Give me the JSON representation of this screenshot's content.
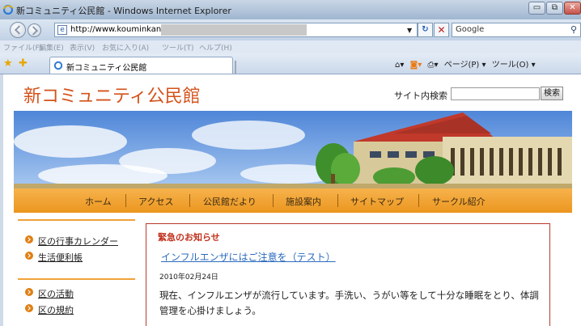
{
  "browser": {
    "window_title": "新コミュニティ公民館 - Windows Internet Explorer",
    "url": "http://www.kouminkan.info",
    "search_engine": "Google",
    "menu": [
      "ファイル(F)",
      "編集(E)",
      "表示(V)",
      "お気に入り(A)",
      "ツール(T)",
      "ヘルプ(H)"
    ],
    "tab_title": "新コミュニティ公民館",
    "toolbar_page": "ページ(P) ▾",
    "toolbar_tools": "ツール(O) ▾",
    "win_min": "▭",
    "win_max": "⧉",
    "win_close": "✕"
  },
  "site": {
    "title": "新コミュニティ公民館",
    "search_label": "サイト内検索",
    "search_button": "検索",
    "nav": [
      "ホーム",
      "アクセス",
      "公民館だより",
      "施設案内",
      "サイトマップ",
      "サークル紹介"
    ],
    "sidebar_group1": [
      "区の行事カレンダー",
      "生活便利帳"
    ],
    "sidebar_group2": [
      "区の活動",
      "区の規約"
    ],
    "notice": {
      "heading": "緊急のお知らせ",
      "link": "インフルエンザにはご注意を（テスト）",
      "date": "2010年02月24日",
      "body": "現在、インフルエンザが流行しています。手洗い、うがい等をして十分な睡眠をとり、体調管理を心掛けましょう。"
    }
  },
  "colors": {
    "title_orange": "#d4521a",
    "nav_orange": "#f0a23a",
    "notice_red": "#c0311d",
    "link_blue": "#2b6bbd"
  }
}
